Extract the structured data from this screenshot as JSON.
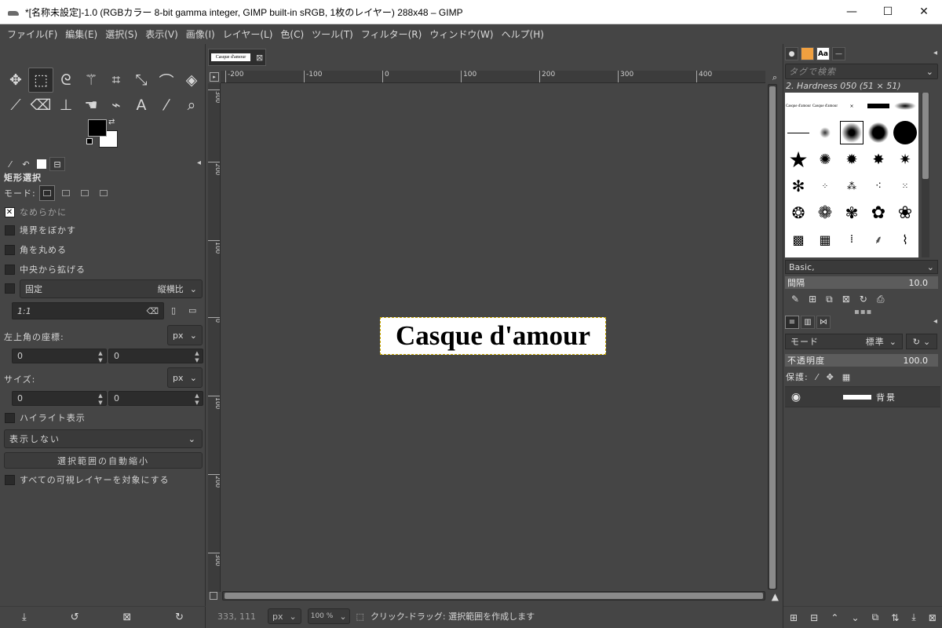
{
  "window": {
    "title": "*[名称未設定]-1.0 (RGBカラー 8-bit gamma integer, GIMP built-in sRGB, 1枚のレイヤー) 288x48 – GIMP",
    "minimize": "—",
    "maximize": "☐",
    "close": "✕"
  },
  "menu": [
    "ファイル(F)",
    "編集(E)",
    "選択(S)",
    "表示(V)",
    "画像(I)",
    "レイヤー(L)",
    "色(C)",
    "ツール(T)",
    "フィルター(R)",
    "ウィンドウ(W)",
    "ヘルプ(H)"
  ],
  "tools": [
    {
      "name": "move-tool",
      "glyph": "✥"
    },
    {
      "name": "rect-select-tool",
      "glyph": "⬚",
      "active": true
    },
    {
      "name": "lasso-tool",
      "glyph": "ᘓ"
    },
    {
      "name": "fuzzy-select-tool",
      "glyph": "⚚"
    },
    {
      "name": "crop-tool",
      "glyph": "⌗"
    },
    {
      "name": "transform-tool",
      "glyph": "⤡"
    },
    {
      "name": "warp-tool",
      "glyph": "⌒"
    },
    {
      "name": "bucket-fill-tool",
      "glyph": "◈"
    },
    {
      "name": "paintbrush-tool",
      "glyph": "⟋"
    },
    {
      "name": "eraser-tool",
      "glyph": "⌫"
    },
    {
      "name": "clone-tool",
      "glyph": "⊥"
    },
    {
      "name": "smudge-tool",
      "glyph": "☚"
    },
    {
      "name": "paths-tool",
      "glyph": "⌁"
    },
    {
      "name": "text-tool",
      "glyph": "A"
    },
    {
      "name": "color-picker-tool",
      "glyph": "⁄"
    },
    {
      "name": "zoom-tool",
      "glyph": "⌕"
    }
  ],
  "tool_options": {
    "title": "矩形選択",
    "mode_label": "モード:",
    "antialias": "なめらかに",
    "feather": "境界をぼかす",
    "rounded": "角を丸める",
    "expand_center": "中央から拡げる",
    "fixed_label": "固定",
    "fixed_value": "縦横比",
    "ratio": "1:1",
    "position_label": "左上角の座標:",
    "unit": "px",
    "pos_x": "0",
    "pos_y": "0",
    "size_label": "サイズ:",
    "size_w": "0",
    "size_h": "0",
    "highlight": "ハイライト表示",
    "guides": "表示しない",
    "auto_shrink": "選択範囲の自動縮小",
    "all_layers": "すべての可視レイヤーを対象にする"
  },
  "image_tab": {
    "thumb_text": "Casque d'amour"
  },
  "ruler_h": [
    "-200",
    "-100",
    "0",
    "100",
    "200",
    "300",
    "400"
  ],
  "ruler_v": [
    "300",
    "200",
    "100",
    "0",
    "100",
    "200",
    "300"
  ],
  "canvas": {
    "text": "Casque d'amour"
  },
  "status": {
    "coords": "333, 111",
    "unit": "px",
    "zoom": "100 %",
    "message": "クリック-ドラッグ: 選択範囲を作成します"
  },
  "brushes": {
    "tag_placeholder": "タグで検索",
    "selected_name": "2. Hardness 050 (51 × 51)",
    "preset": "Basic,",
    "spacing_label": "間隔",
    "spacing_value": "10.0",
    "sample_text": "Casque d'amour"
  },
  "layers": {
    "mode_label": "モード",
    "mode_value": "標準",
    "opacity_label": "不透明度",
    "opacity_value": "100.0",
    "lock_label": "保護:",
    "items": [
      {
        "name": "背景"
      }
    ]
  }
}
